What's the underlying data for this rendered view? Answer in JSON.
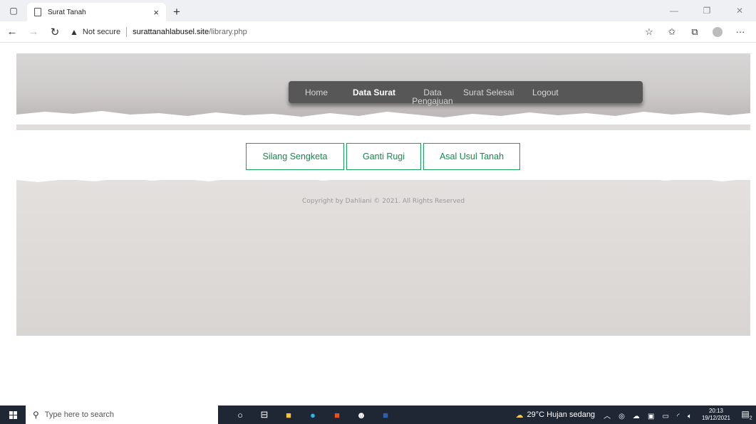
{
  "browser": {
    "tab_title": "Surat Tanah",
    "close_glyph": "×",
    "new_tab_glyph": "+",
    "security_label": "Not secure",
    "url_domain": "surattanahlabusel.site",
    "url_path": "/library.php"
  },
  "nav": {
    "items": [
      {
        "label": "Home"
      },
      {
        "label": "Data Surat",
        "active": true
      },
      {
        "label": "Data Pengajuan"
      },
      {
        "label": "Surat Selesai"
      },
      {
        "label": "Logout"
      }
    ]
  },
  "buttons": {
    "silang": "Silang Sengketa",
    "ganti": "Ganti Rugi",
    "asal": "Asal Usul Tanah"
  },
  "footer": {
    "copyright": "Copyright by Dahliani © 2021. All Rights Reserved"
  },
  "taskbar": {
    "search_placeholder": "Type here to search",
    "weather": "29°C  Hujan sedang",
    "time": "20:13",
    "date": "19/12/2021",
    "notif_count": "2"
  },
  "colors": {
    "accent_green": "#1aa15a",
    "nav_bg": "#585757"
  }
}
